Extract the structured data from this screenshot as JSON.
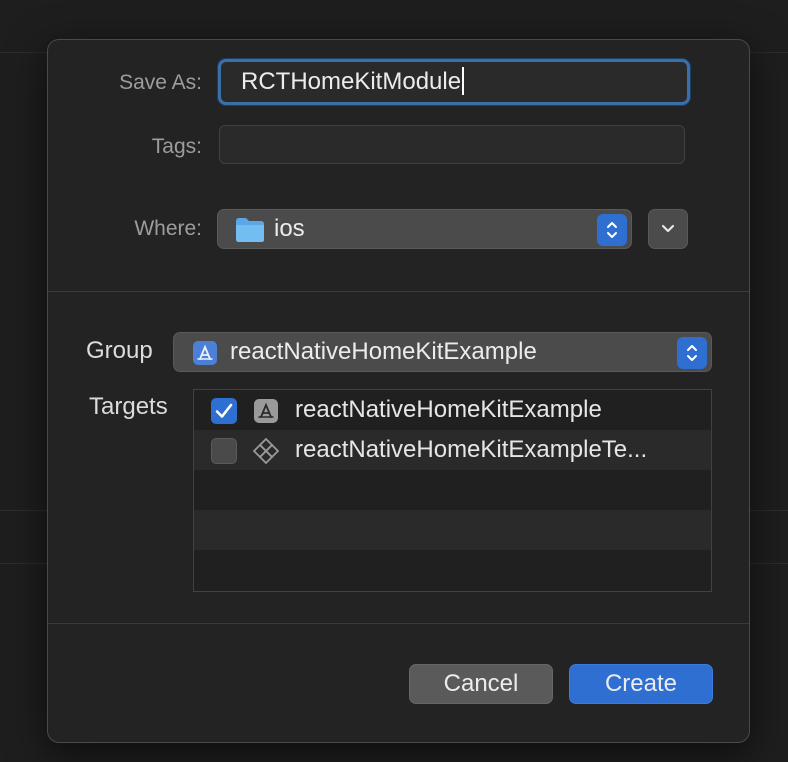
{
  "form": {
    "save_as_label": "Save As:",
    "save_as_value": "RCTHomeKitModule",
    "tags_label": "Tags:",
    "tags_value": "",
    "where_label": "Where:",
    "where_value": "ios"
  },
  "project": {
    "group_label": "Group",
    "group_value": "reactNativeHomeKitExample",
    "targets_label": "Targets",
    "targets": [
      {
        "label": "reactNativeHomeKitExample",
        "checked": true,
        "icon": "app-target-icon"
      },
      {
        "label": "reactNativeHomeKitExampleTe...",
        "checked": false,
        "icon": "test-target-icon"
      }
    ]
  },
  "buttons": {
    "cancel": "Cancel",
    "create": "Create"
  },
  "colors": {
    "accent": "#2f6fd1",
    "focus_ring": "#3a6fa8"
  }
}
